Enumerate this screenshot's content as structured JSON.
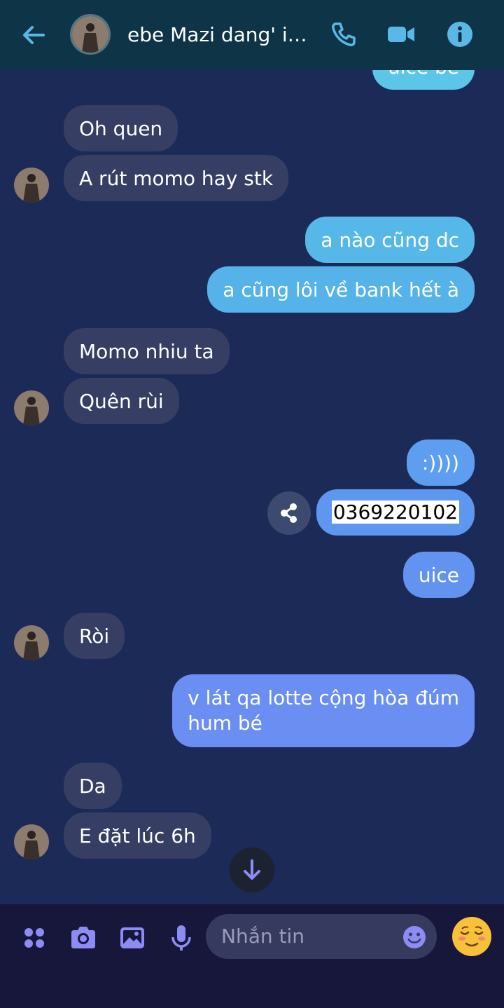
{
  "header": {
    "title": "ebe Mazi dang' iu...",
    "colors": {
      "background": "#0d3447",
      "icon": "#5ab8e6"
    }
  },
  "messages": [
    {
      "id": "m0",
      "side": "out",
      "text": "uice be",
      "partial": true
    },
    {
      "id": "m1",
      "side": "in",
      "text": "Oh quen"
    },
    {
      "id": "m2",
      "side": "in",
      "text": "A rút momo hay stk"
    },
    {
      "id": "m3",
      "side": "out",
      "text": "a nào cũng dc"
    },
    {
      "id": "m4",
      "side": "out",
      "text": "a cũng lôi về bank hết à"
    },
    {
      "id": "m5",
      "side": "in",
      "text": "Momo nhiu ta"
    },
    {
      "id": "m6",
      "side": "in",
      "text": "Quên rùi"
    },
    {
      "id": "m7",
      "side": "out",
      "text": ":))))"
    },
    {
      "id": "m8",
      "side": "out",
      "text": "0369220102",
      "selected": true
    },
    {
      "id": "m9",
      "side": "out",
      "text": "uice"
    },
    {
      "id": "m10",
      "side": "in",
      "text": "Ròi"
    },
    {
      "id": "m11",
      "side": "out",
      "text": "v lát qa lotte cộng hòa đúm\nhum bé"
    },
    {
      "id": "m12",
      "side": "in",
      "text": "Da"
    },
    {
      "id": "m13",
      "side": "in",
      "text": "E đặt lúc 6h"
    }
  ],
  "composer": {
    "placeholder": "Nhắn tin",
    "colors": {
      "background": "#17173c",
      "icon": "#8d8cf5"
    }
  },
  "colors": {
    "chat_background": "#1b2a56",
    "incoming_bubble": "#363f63"
  }
}
